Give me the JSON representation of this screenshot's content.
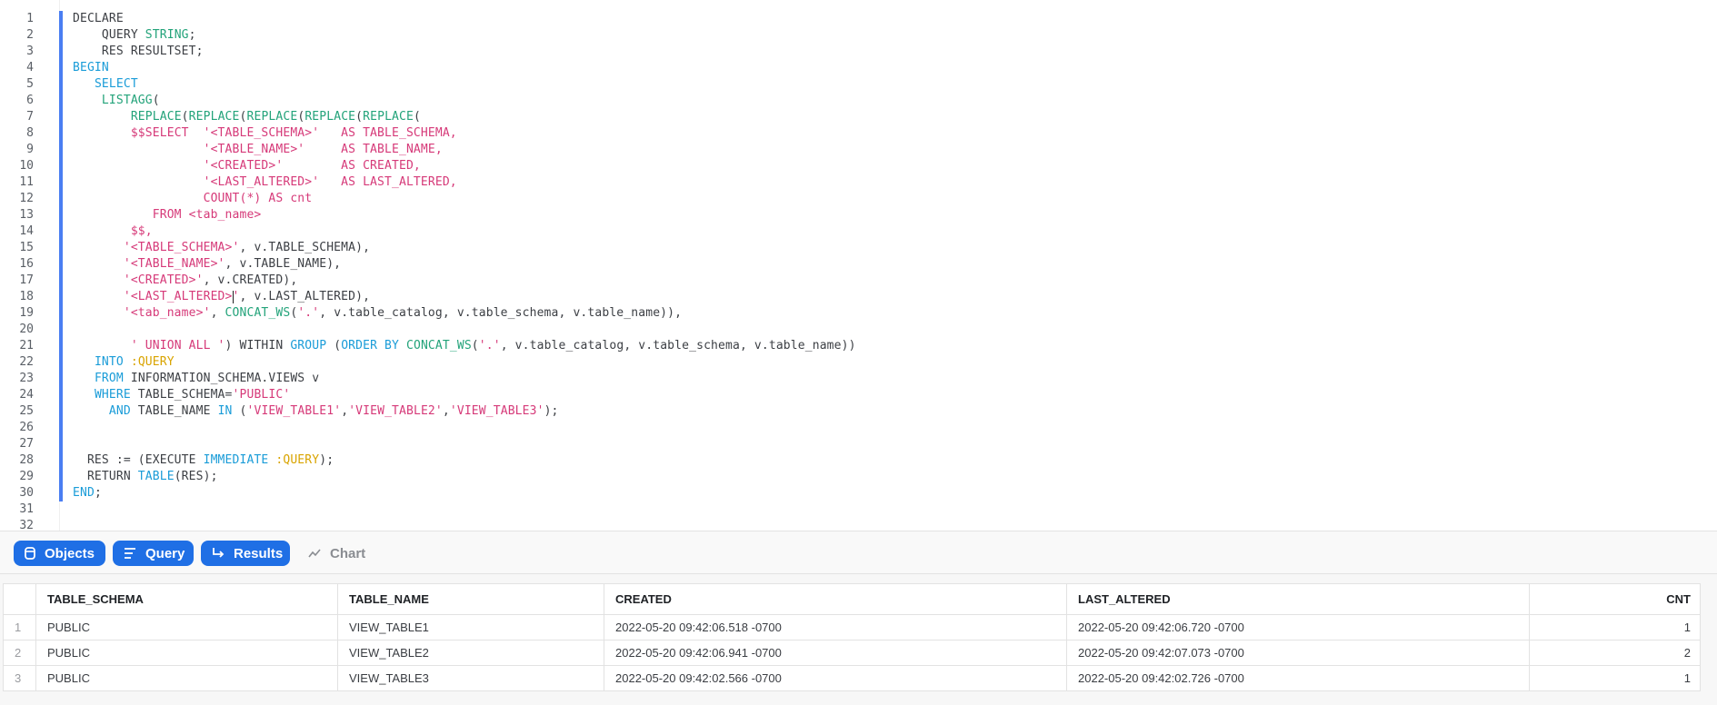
{
  "editor": {
    "line_numbers": [
      "1",
      "2",
      "3",
      "4",
      "5",
      "6",
      "7",
      "8",
      "9",
      "10",
      "11",
      "12",
      "13",
      "14",
      "15",
      "16",
      "17",
      "18",
      "19",
      "20",
      "21",
      "22",
      "23",
      "24",
      "25",
      "26",
      "27",
      "28",
      "29",
      "30",
      "31",
      "32"
    ],
    "lines": [
      [
        [
          "plain",
          "DECLARE"
        ]
      ],
      [
        [
          "plain",
          "    QUERY "
        ],
        [
          "fn",
          "STRING"
        ],
        [
          "plain",
          ";"
        ]
      ],
      [
        [
          "plain",
          "    RES RESULTSET;"
        ]
      ],
      [
        [
          "kw",
          "BEGIN"
        ]
      ],
      [
        [
          "plain",
          "   "
        ],
        [
          "kw",
          "SELECT"
        ]
      ],
      [
        [
          "plain",
          "    "
        ],
        [
          "fn",
          "LISTAGG"
        ],
        [
          "plain",
          "("
        ]
      ],
      [
        [
          "plain",
          "        "
        ],
        [
          "fn",
          "REPLACE"
        ],
        [
          "plain",
          "("
        ],
        [
          "fn",
          "REPLACE"
        ],
        [
          "plain",
          "("
        ],
        [
          "fn",
          "REPLACE"
        ],
        [
          "plain",
          "("
        ],
        [
          "fn",
          "REPLACE"
        ],
        [
          "plain",
          "("
        ],
        [
          "fn",
          "REPLACE"
        ],
        [
          "plain",
          "("
        ]
      ],
      [
        [
          "plain",
          "        "
        ],
        [
          "str",
          "$$SELECT  '<TABLE_SCHEMA>'   AS TABLE_SCHEMA,"
        ]
      ],
      [
        [
          "plain",
          "                  "
        ],
        [
          "str",
          "'<TABLE_NAME>'     AS TABLE_NAME,"
        ]
      ],
      [
        [
          "plain",
          "                  "
        ],
        [
          "str",
          "'<CREATED>'        AS CREATED,"
        ]
      ],
      [
        [
          "plain",
          "                  "
        ],
        [
          "str",
          "'<LAST_ALTERED>'   AS LAST_ALTERED,"
        ]
      ],
      [
        [
          "plain",
          "                  "
        ],
        [
          "str",
          "COUNT(*) AS cnt"
        ]
      ],
      [
        [
          "plain",
          "           "
        ],
        [
          "str",
          "FROM <tab_name>"
        ]
      ],
      [
        [
          "plain",
          "        "
        ],
        [
          "str",
          "$$,"
        ]
      ],
      [
        [
          "plain",
          "       "
        ],
        [
          "str",
          "'<TABLE_SCHEMA>'"
        ],
        [
          "plain",
          ", v.TABLE_SCHEMA),"
        ]
      ],
      [
        [
          "plain",
          "       "
        ],
        [
          "str",
          "'<TABLE_NAME>'"
        ],
        [
          "plain",
          ", v.TABLE_NAME),"
        ]
      ],
      [
        [
          "plain",
          "       "
        ],
        [
          "str",
          "'<CREATED>'"
        ],
        [
          "plain",
          ", v.CREATED),"
        ]
      ],
      [
        [
          "plain",
          "       "
        ],
        [
          "str",
          "'<LAST_ALTERED>"
        ],
        [
          "cursor",
          ""
        ],
        [
          "str",
          "'"
        ],
        [
          "plain",
          ", v.LAST_ALTERED),"
        ]
      ],
      [
        [
          "plain",
          "       "
        ],
        [
          "str",
          "'<tab_name>'"
        ],
        [
          "plain",
          ", "
        ],
        [
          "fn",
          "CONCAT_WS"
        ],
        [
          "plain",
          "("
        ],
        [
          "str",
          "'.'"
        ],
        [
          "plain",
          ", v.table_catalog, v.table_schema, v.table_name)),"
        ]
      ],
      [],
      [
        [
          "plain",
          "        "
        ],
        [
          "str",
          "' UNION ALL '"
        ],
        [
          "plain",
          ") WITHIN "
        ],
        [
          "kw",
          "GROUP"
        ],
        [
          "plain",
          " ("
        ],
        [
          "kw",
          "ORDER BY"
        ],
        [
          "plain",
          " "
        ],
        [
          "fn",
          "CONCAT_WS"
        ],
        [
          "plain",
          "("
        ],
        [
          "str",
          "'.'"
        ],
        [
          "plain",
          ", v.table_catalog, v.table_schema, v.table_name))"
        ]
      ],
      [
        [
          "plain",
          "   "
        ],
        [
          "kw",
          "INTO"
        ],
        [
          "plain",
          " "
        ],
        [
          "var",
          ":QUERY"
        ]
      ],
      [
        [
          "plain",
          "   "
        ],
        [
          "kw",
          "FROM"
        ],
        [
          "plain",
          " INFORMATION_SCHEMA.VIEWS v"
        ]
      ],
      [
        [
          "plain",
          "   "
        ],
        [
          "kw",
          "WHERE"
        ],
        [
          "plain",
          " TABLE_SCHEMA="
        ],
        [
          "str",
          "'PUBLIC'"
        ]
      ],
      [
        [
          "plain",
          "     "
        ],
        [
          "kw",
          "AND"
        ],
        [
          "plain",
          " TABLE_NAME "
        ],
        [
          "kw",
          "IN"
        ],
        [
          "plain",
          " ("
        ],
        [
          "str",
          "'VIEW_TABLE1'"
        ],
        [
          "plain",
          ","
        ],
        [
          "str",
          "'VIEW_TABLE2'"
        ],
        [
          "plain",
          ","
        ],
        [
          "str",
          "'VIEW_TABLE3'"
        ],
        [
          "plain",
          ");"
        ]
      ],
      [],
      [],
      [
        [
          "plain",
          "  RES := (EXECUTE "
        ],
        [
          "kw",
          "IMMEDIATE"
        ],
        [
          "plain",
          " "
        ],
        [
          "var",
          ":QUERY"
        ],
        [
          "plain",
          ");"
        ]
      ],
      [
        [
          "plain",
          "  RETURN "
        ],
        [
          "kw",
          "TABLE"
        ],
        [
          "plain",
          "(RES);"
        ]
      ],
      [
        [
          "kw",
          "END"
        ],
        [
          "plain",
          ";"
        ]
      ],
      [],
      []
    ]
  },
  "toolbar": {
    "objects_label": "Objects",
    "query_label": "Query",
    "results_label": "Results",
    "chart_label": "Chart"
  },
  "results": {
    "columns": [
      "",
      "TABLE_SCHEMA",
      "TABLE_NAME",
      "CREATED",
      "LAST_ALTERED",
      "CNT"
    ],
    "rows": [
      [
        "1",
        "PUBLIC",
        "VIEW_TABLE1",
        "2022-05-20 09:42:06.518 -0700",
        "2022-05-20 09:42:06.720 -0700",
        "1"
      ],
      [
        "2",
        "PUBLIC",
        "VIEW_TABLE2",
        "2022-05-20 09:42:06.941 -0700",
        "2022-05-20 09:42:07.073 -0700",
        "2"
      ],
      [
        "3",
        "PUBLIC",
        "VIEW_TABLE3",
        "2022-05-20 09:42:02.566 -0700",
        "2022-05-20 09:42:02.726 -0700",
        "1"
      ]
    ]
  },
  "colors": {
    "accent": "#1f6fe5",
    "keyword": "#1a9cd8",
    "function": "#23a37a",
    "string": "#d63a79",
    "variable": "#d9a400",
    "active_line_bar": "#4a7ef2"
  }
}
